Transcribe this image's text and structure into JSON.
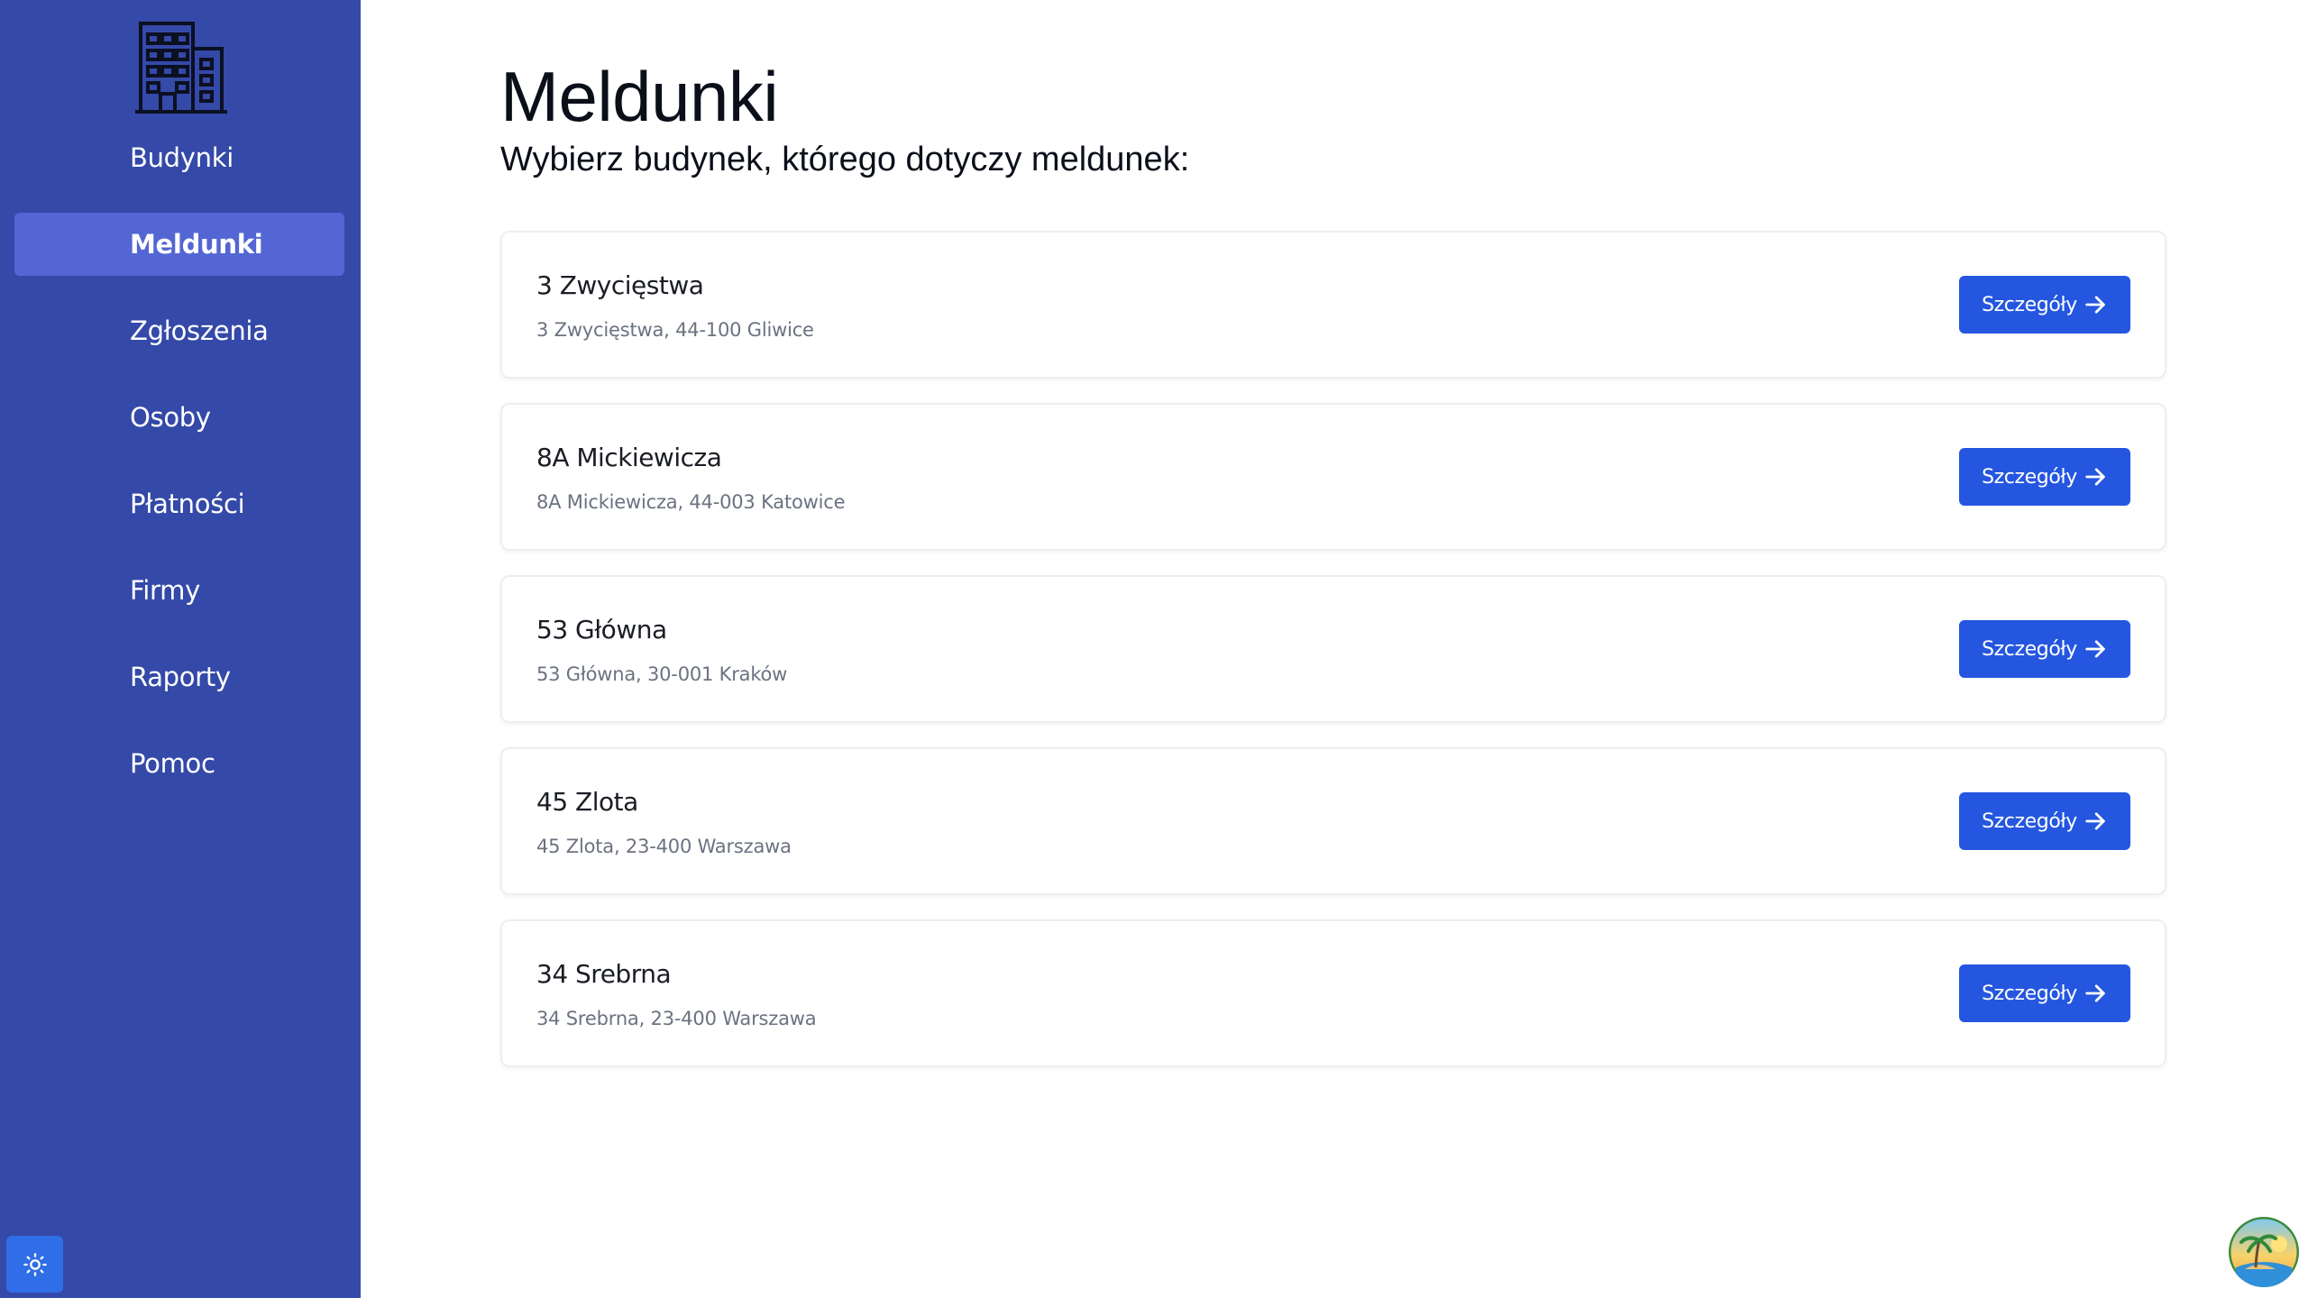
{
  "sidebar": {
    "logo_icon": "building-icon",
    "items": [
      {
        "label": "Budynki",
        "active": false
      },
      {
        "label": "Meldunki",
        "active": true
      },
      {
        "label": "Zgłoszenia",
        "active": false
      },
      {
        "label": "Osoby",
        "active": false
      },
      {
        "label": "Płatności",
        "active": false
      },
      {
        "label": "Firmy",
        "active": false
      },
      {
        "label": "Raporty",
        "active": false
      },
      {
        "label": "Pomoc",
        "active": false
      }
    ],
    "theme_toggle_icon": "sun-icon"
  },
  "main": {
    "title": "Meldunki",
    "subtitle": "Wybierz budynek, którego dotyczy meldunek:",
    "buildings": [
      {
        "name": "3 Zwycięstwa",
        "address": "3 Zwycięstwa, 44-100 Gliwice",
        "button_label": "Szczegóły"
      },
      {
        "name": "8A Mickiewicza",
        "address": "8A Mickiewicza, 44-003 Katowice",
        "button_label": "Szczegóły"
      },
      {
        "name": "53 Główna",
        "address": "53 Główna, 30-001 Kraków",
        "button_label": "Szczegóły"
      },
      {
        "name": "45 Zlota",
        "address": "45 Zlota, 23-400 Warszawa",
        "button_label": "Szczegóły"
      },
      {
        "name": "34 Srebrna",
        "address": "34 Srebrna, 23-400 Warszawa",
        "button_label": "Szczegóły"
      }
    ]
  },
  "colors": {
    "sidebar_bg": "#3449a8",
    "sidebar_active": "#5366d4",
    "button_primary": "#2456e0",
    "theme_button": "#2f6ee6"
  }
}
